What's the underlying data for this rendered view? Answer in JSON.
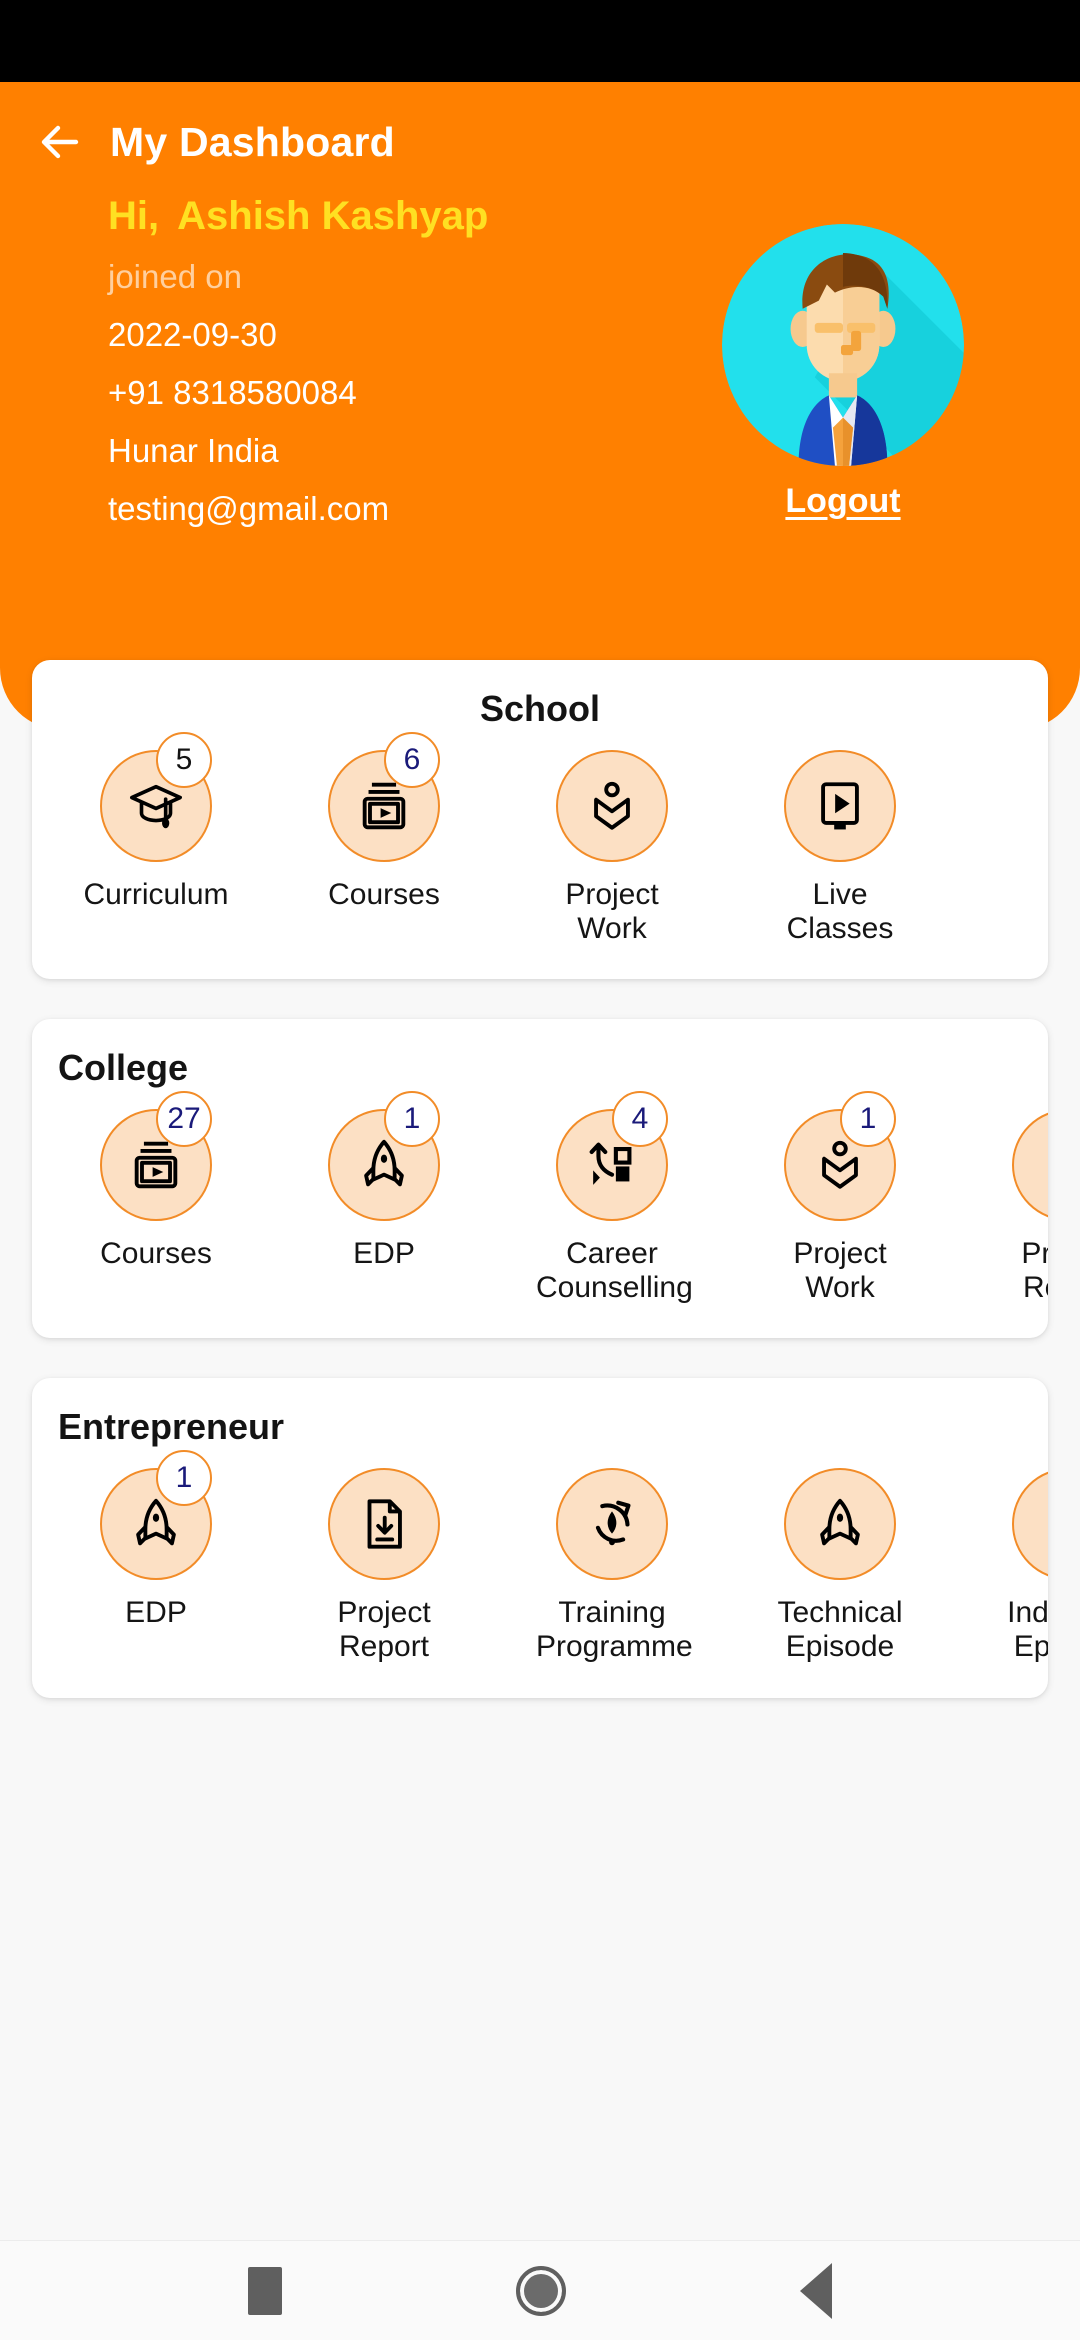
{
  "header": {
    "back_icon": "arrow-left-icon",
    "title": "My Dashboard",
    "greeting_prefix": "Hi,",
    "user_name": "Ashish Kashyap",
    "joined_label": "joined on",
    "joined_date": "2022-09-30",
    "phone": "+91 8318580084",
    "organization": "Hunar India",
    "email": "testing@gmail.com",
    "logout_label": "Logout",
    "avatar_icon": "user-avatar-icon",
    "colors": {
      "background": "#FF8000",
      "greeting_text": "#FFE022",
      "body_text": "#FFFFFF",
      "muted_text": "rgba(255,255,255,0.62)",
      "avatar_circle": "#22E0EC",
      "avatar_suit": "#1F4FC4",
      "avatar_hair": "#8A4B10",
      "avatar_tie": "#F5A23C"
    }
  },
  "theme": {
    "page_background": "#F8F8F8",
    "card_background": "#FFFFFF",
    "icon_circle_fill": "#FCE0C4",
    "icon_circle_border": "#F28C28",
    "badge_number": "#1A1A7A",
    "status_bar": "#000000"
  },
  "sections": [
    {
      "title": "School",
      "title_align": "center",
      "items": [
        {
          "label": "Curriculum",
          "icon": "graduation-cap-icon",
          "badge": "5",
          "badge_dark": true
        },
        {
          "label": "Courses",
          "icon": "course-video-icon",
          "badge": "6",
          "badge_dark": false
        },
        {
          "label": "Project\nWork",
          "icon": "open-book-icon",
          "badge": null,
          "badge_dark": false
        },
        {
          "label": "Live\nClasses",
          "icon": "live-play-icon",
          "badge": null,
          "badge_dark": false
        }
      ]
    },
    {
      "title": "College",
      "title_align": "left",
      "items": [
        {
          "label": "Courses",
          "icon": "course-video-icon",
          "badge": "27",
          "badge_dark": false
        },
        {
          "label": "EDP",
          "icon": "rocket-icon",
          "badge": "1",
          "badge_dark": false
        },
        {
          "label": "Career\nCounselling",
          "icon": "career-arrow-icon",
          "badge": "4",
          "badge_dark": false
        },
        {
          "label": "Project\nWork",
          "icon": "open-book-icon",
          "badge": "1",
          "badge_dark": false
        },
        {
          "label": "Project\nReport",
          "icon": "document-download-icon",
          "badge": null,
          "badge_dark": false
        }
      ]
    },
    {
      "title": "Entrepreneur",
      "title_align": "left",
      "items": [
        {
          "label": "EDP",
          "icon": "rocket-icon",
          "badge": "1",
          "badge_dark": false
        },
        {
          "label": "Project\nReport",
          "icon": "document-download-icon",
          "badge": null,
          "badge_dark": false
        },
        {
          "label": "Training\nProgramme",
          "icon": "training-refresh-icon",
          "badge": null,
          "badge_dark": false
        },
        {
          "label": "Technical\nEpisode",
          "icon": "rocket-icon",
          "badge": null,
          "badge_dark": false
        },
        {
          "label": "Industrial\nEpisode",
          "icon": "rocket-icon",
          "badge": null,
          "badge_dark": false
        }
      ]
    }
  ],
  "navbar": {
    "recents_icon": "square-recents-icon",
    "home_icon": "circle-home-icon",
    "back_icon": "triangle-back-icon"
  }
}
